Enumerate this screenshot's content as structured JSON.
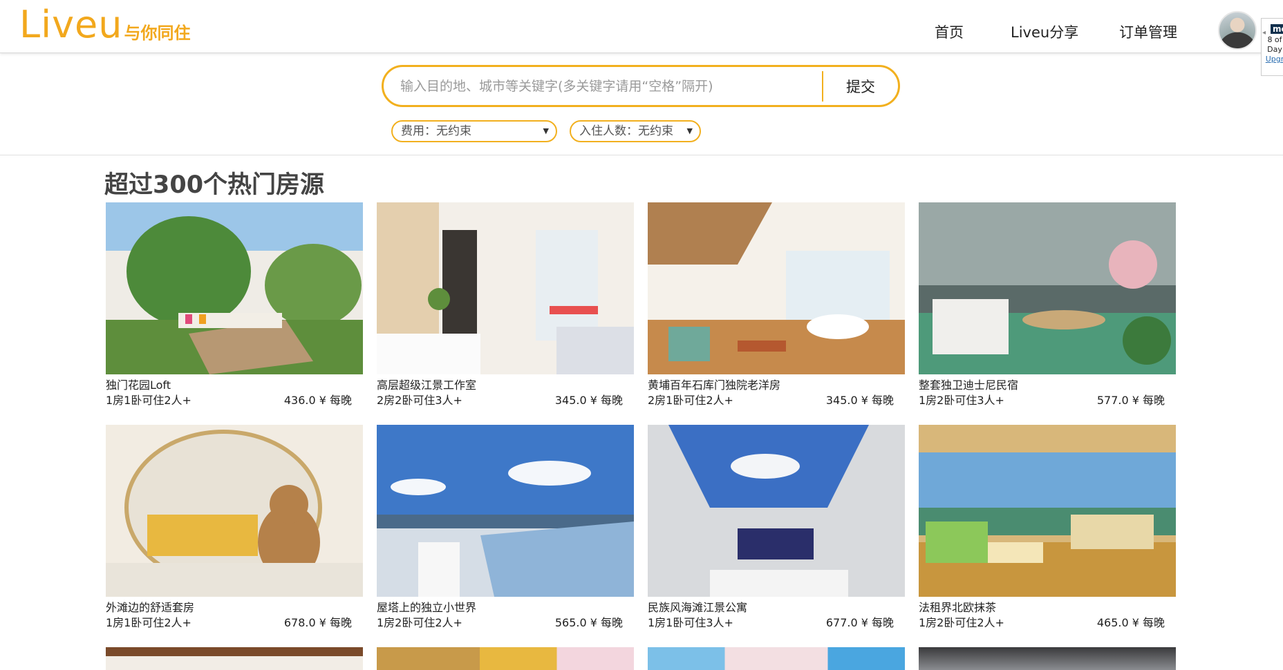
{
  "header": {
    "logo_main": "Liveu",
    "logo_tagline": "与你同住",
    "nav": [
      {
        "label": "首页"
      },
      {
        "label": "Liveu分享"
      },
      {
        "label": "订单管理"
      }
    ],
    "extension_badge": {
      "label": "me",
      "line1": "8 of",
      "line2": "Day",
      "link": "Upgr"
    }
  },
  "search": {
    "placeholder": "输入目的地、城市等关键字(多关键字请用“空格”隔开)",
    "submit_label": "提交"
  },
  "filters": {
    "price": {
      "selected": "费用：无约束"
    },
    "guests": {
      "selected": "入住人数：无约束"
    }
  },
  "section_title": "超过300个热门房源",
  "listings": [
    {
      "title": "独门花园Loft",
      "spec": "1房1卧可住2人+",
      "price": "436.0 ¥ 每晚"
    },
    {
      "title": "高层超级江景工作室",
      "spec": "2房2卧可住3人+",
      "price": "345.0 ¥ 每晚"
    },
    {
      "title": "黄埔百年石库门独院老洋房",
      "spec": "2房1卧可住2人+",
      "price": "345.0 ¥ 每晚"
    },
    {
      "title": "整套独卫迪士尼民宿",
      "spec": "1房2卧可住3人+",
      "price": "577.0 ¥ 每晚"
    },
    {
      "title": "外滩边的舒适套房",
      "spec": "1房1卧可住2人+",
      "price": "678.0 ¥ 每晚"
    },
    {
      "title": "屋塔上的独立小世界",
      "spec": "1房2卧可住2人+",
      "price": "565.0 ¥ 每晚"
    },
    {
      "title": "民族风海滩江景公寓",
      "spec": "1房1卧可住3人+",
      "price": "677.0 ¥ 每晚"
    },
    {
      "title": "法租界北欧抹茶",
      "spec": "1房2卧可住2人+",
      "price": "465.0 ¥ 每晚"
    }
  ]
}
